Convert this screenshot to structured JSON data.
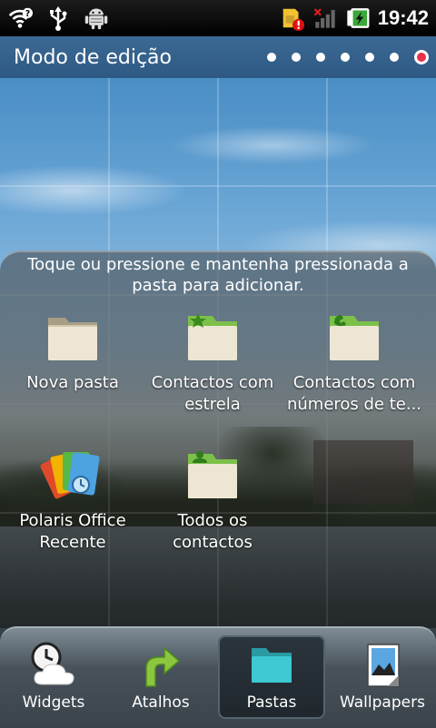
{
  "status_bar": {
    "time": "19:42",
    "icons": [
      "wifi-icon",
      "usb-icon",
      "android-debug-icon",
      "sim-alert-icon",
      "no-signal-icon",
      "battery-charging-icon"
    ]
  },
  "edit_header": {
    "title": "Modo de edição",
    "page_count": 7,
    "active_page": 7
  },
  "picker": {
    "hint": "Toque ou pressione e mantenha pressionada a pasta para adicionar.",
    "items": [
      {
        "label": "Nova pasta",
        "icon": "folder-icon"
      },
      {
        "label": "Contactos com estrela",
        "line1": "Contactos com",
        "line2": "estrela",
        "icon": "folder-star-icon"
      },
      {
        "label": "Contactos com números de te...",
        "line1": "Contactos com",
        "line2": "números de te...",
        "icon": "folder-phone-icon"
      },
      {
        "label": "Polaris Office Recente",
        "line1": "Polaris Office",
        "line2": "Recente",
        "icon": "polaris-office-icon"
      },
      {
        "label": "Todos os contactos",
        "line1": "Todos os",
        "line2": "contactos",
        "icon": "folder-contact-icon"
      }
    ]
  },
  "tabs": [
    {
      "label": "Widgets",
      "icon": "widgets-clock-cloud-icon",
      "active": false
    },
    {
      "label": "Atalhos",
      "icon": "shortcut-arrow-icon",
      "active": false
    },
    {
      "label": "Pastas",
      "icon": "folder-icon",
      "active": true
    },
    {
      "label": "Wallpapers",
      "icon": "wallpaper-icon",
      "active": false
    }
  ],
  "colors": {
    "active_dot": "#e8304a",
    "shortcut_green": "#8cc63f",
    "folder_tab_green": "#7cc04a",
    "pastas_folder_teal": "#3ec8d0"
  }
}
